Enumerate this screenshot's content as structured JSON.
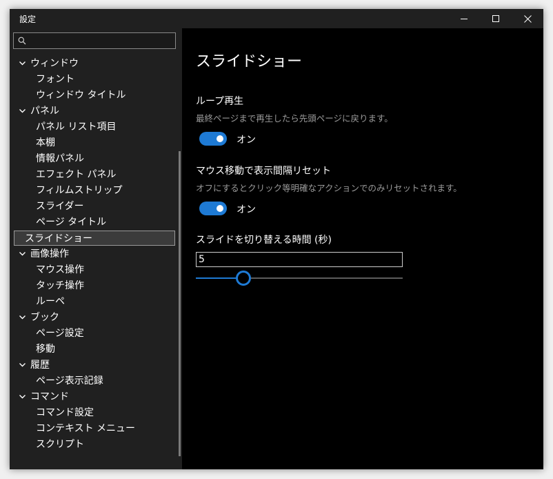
{
  "window": {
    "title": "設定"
  },
  "search": {
    "placeholder": ""
  },
  "tree": [
    {
      "label": "ウィンドウ",
      "level": 0
    },
    {
      "label": "フォント",
      "level": 1
    },
    {
      "label": "ウィンドウ タイトル",
      "level": 1
    },
    {
      "label": "パネル",
      "level": 0
    },
    {
      "label": "パネル リスト項目",
      "level": 1
    },
    {
      "label": "本棚",
      "level": 1
    },
    {
      "label": "情報パネル",
      "level": 1
    },
    {
      "label": "エフェクト パネル",
      "level": 1
    },
    {
      "label": "フィルムストリップ",
      "level": 1
    },
    {
      "label": "スライダー",
      "level": 1
    },
    {
      "label": "ページ タイトル",
      "level": 1
    },
    {
      "label": "スライドショー",
      "level": 0,
      "selected": true
    },
    {
      "label": "画像操作",
      "level": 0
    },
    {
      "label": "マウス操作",
      "level": 1
    },
    {
      "label": "タッチ操作",
      "level": 1
    },
    {
      "label": "ルーペ",
      "level": 1
    },
    {
      "label": "ブック",
      "level": 0
    },
    {
      "label": "ページ設定",
      "level": 1
    },
    {
      "label": "移動",
      "level": 1
    },
    {
      "label": "履歴",
      "level": 0
    },
    {
      "label": "ページ表示記録",
      "level": 1
    },
    {
      "label": "コマンド",
      "level": 0
    },
    {
      "label": "コマンド設定",
      "level": 1
    },
    {
      "label": "コンテキスト メニュー",
      "level": 1
    },
    {
      "label": "スクリプト",
      "level": 1
    }
  ],
  "content": {
    "title": "スライドショー",
    "loop": {
      "heading": "ループ再生",
      "description": "最終ページまで再生したら先頭ページに戻ります。",
      "state_label": "オン",
      "on": true
    },
    "mouse_reset": {
      "heading": "マウス移動で表示間隔リセット",
      "description": "オフにするとクリック等明確なアクションでのみリセットされます。",
      "state_label": "オン",
      "on": true
    },
    "interval": {
      "heading": "スライドを切り替える時間 (秒)",
      "value": "5",
      "slider_fraction": 0.23
    }
  },
  "colors": {
    "accent": "#1e7ad4",
    "sidebar_bg": "#202020",
    "content_bg": "#000000"
  }
}
